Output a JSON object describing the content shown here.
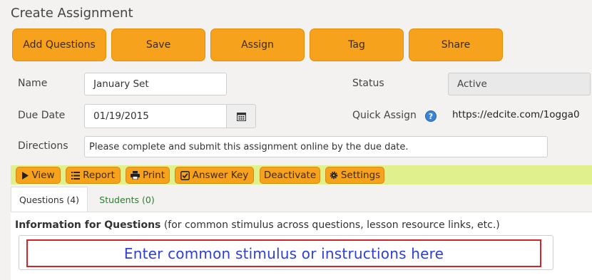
{
  "page": {
    "title": "Create Assignment"
  },
  "toolbar": {
    "add_questions": "Add Questions",
    "save": "Save",
    "assign": "Assign",
    "tag": "Tag",
    "share": "Share"
  },
  "form": {
    "name_label": "Name",
    "name_value": "January Set",
    "status_label": "Status",
    "status_value": "Active",
    "due_label": "Due Date",
    "due_value": "01/19/2015",
    "quick_label": "Quick Assign",
    "quick_help": "?",
    "quick_link": "https://edcite.com/1ogga0",
    "directions_label": "Directions",
    "directions_value": "Please complete and submit this assignment online by the due date."
  },
  "actions": {
    "view": "View",
    "report": "Report",
    "print": "Print",
    "answer_key": "Answer Key",
    "deactivate": "Deactivate",
    "settings": "Settings"
  },
  "tabs": {
    "questions": "Questions (4)",
    "students": "Students (0)"
  },
  "info": {
    "heading_bold": "Information for Questions",
    "heading_rest": " (for common stimulus across questions, lesson resource links, etc.)",
    "placeholder": "Enter common stimulus or instructions here"
  },
  "colors": {
    "accent_orange": "#f7a21c",
    "action_bar": "#dff08c",
    "tab_link_green": "#2f7a2f",
    "highlight_red": "#d4232a",
    "stimulus_blue": "#2f3fd6"
  }
}
